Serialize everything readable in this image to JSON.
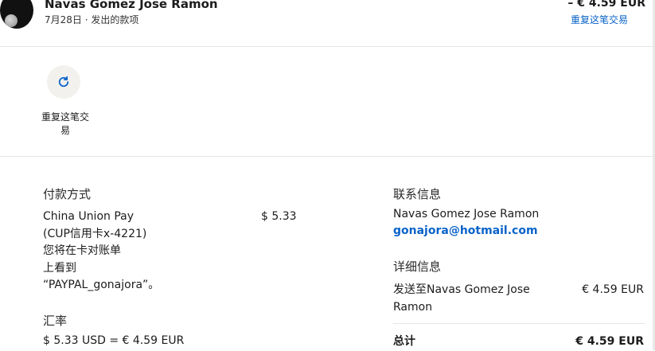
{
  "header": {
    "name": "Navas Gomez Jose Ramon",
    "subtitle": "7月28日 · 发出的款项",
    "amount": "– € 4.59 EUR",
    "repeat_link": "重复这笔交易"
  },
  "actions": {
    "repeat_label_line1": "重复这笔交",
    "repeat_label_line2": "易"
  },
  "payment": {
    "title": "付款方式",
    "method_line1": "China Union Pay",
    "method_line2": "(CUP信用卡x-4221)",
    "method_line3": "您将在卡对账单",
    "method_line4": "上看到",
    "method_line5": "“PAYPAL_gonajora”。",
    "amount": "$ 5.33"
  },
  "exchange": {
    "title": "汇率",
    "value": "$ 5.33 USD = € 4.59 EUR"
  },
  "contact": {
    "title": "联系信息",
    "name": "Navas Gomez Jose Ramon",
    "email": "gonajora@hotmail.com"
  },
  "details": {
    "title": "详细信息",
    "sent_to_line1": "发送至Navas Gomez Jose",
    "sent_to_line2": "Ramon",
    "sent_amount": "€ 4.59 EUR",
    "total_label": "总计",
    "total_amount": "€ 4.59 EUR"
  },
  "colors": {
    "link": "#0a63c9",
    "divider": "#e5e5e5",
    "icon_bg": "#f2f1ee"
  }
}
